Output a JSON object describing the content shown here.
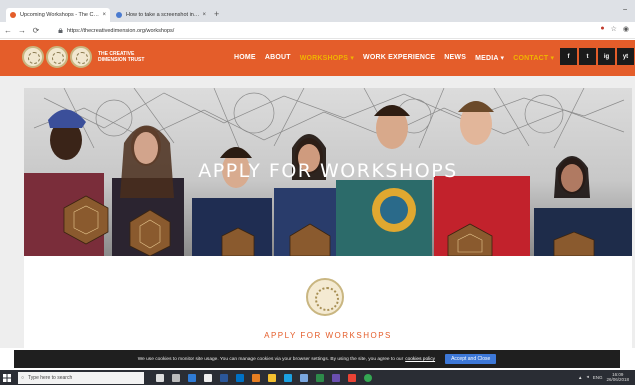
{
  "browser": {
    "tabs": [
      {
        "title": "Upcoming Workshops - The Creative Dimension Trust",
        "active": true,
        "favicon_color": "#e45d2a"
      },
      {
        "title": "How to take a screenshot in Chrome",
        "active": false,
        "favicon_color": "#4a7bd0"
      }
    ],
    "new_tab_glyph": "+",
    "back_glyph": "←",
    "forward_glyph": "→",
    "reload_glyph": "⟳",
    "url": "https://thecreativedimension.org/workshops/",
    "minimize_glyph": "‒"
  },
  "site": {
    "logo_text": "THE CREATIVE DIMENSION TRUST",
    "nav": [
      {
        "label": "HOME",
        "highlight": false
      },
      {
        "label": "ABOUT",
        "highlight": false
      },
      {
        "label": "WORKSHOPS ▾",
        "highlight": true
      },
      {
        "label": "WORK EXPERIENCE",
        "highlight": false
      },
      {
        "label": "NEWS",
        "highlight": false
      },
      {
        "label": "MEDIA ▾",
        "highlight": false
      },
      {
        "label": "CONTACT ▾",
        "highlight": true
      }
    ],
    "social": [
      "f",
      "t",
      "ig",
      "yt"
    ],
    "hero_title": "APPLY FOR WORKSHOPS",
    "section_title": "APPLY FOR WORKSHOPS",
    "colors": {
      "brand": "#e45d2a",
      "nav_highlight": "#f0b400",
      "gold": "#c9b681"
    }
  },
  "cookie": {
    "text": "We use cookies to monitor site usage. You can manage cookies via your browser settings. By using the site, you agree to our",
    "link": "cookies policy",
    "button": "Accept and Close"
  },
  "taskbar": {
    "search_placeholder": "Type here to search",
    "time": "16:09",
    "date": "26/06/2018",
    "language": "ENG"
  }
}
